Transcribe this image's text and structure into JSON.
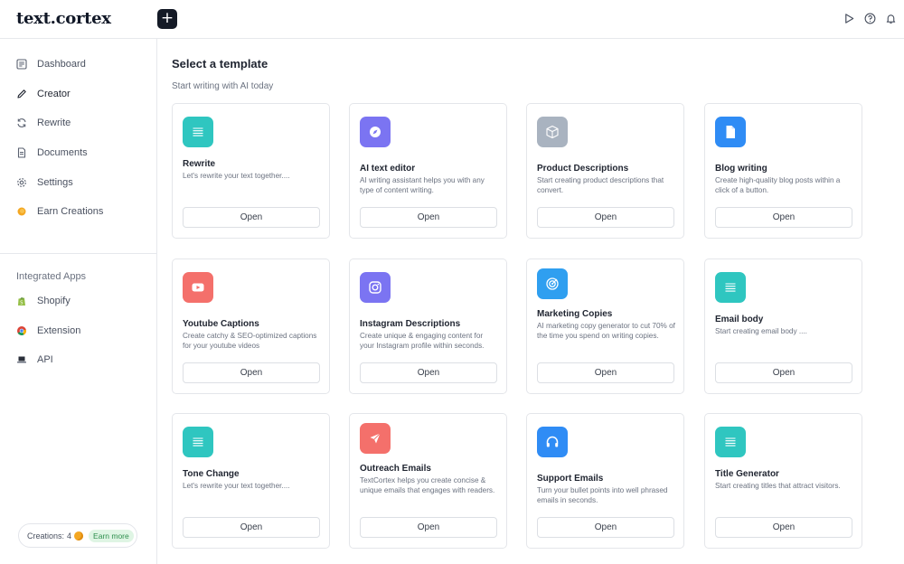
{
  "app": {
    "logo": "text.cortex",
    "new_button": "+"
  },
  "topbar": {
    "icons": [
      "play-icon",
      "help-icon",
      "bell-icon"
    ]
  },
  "sidebar": {
    "items": [
      {
        "label": "Dashboard",
        "icon": "dashboard-icon"
      },
      {
        "label": "Creator",
        "icon": "pencil-icon",
        "active": true
      },
      {
        "label": "Rewrite",
        "icon": "refresh-icon"
      },
      {
        "label": "Documents",
        "icon": "document-icon"
      },
      {
        "label": "Settings",
        "icon": "gear-icon"
      },
      {
        "label": "Earn Creations",
        "icon": "coin-icon"
      }
    ],
    "integrated_title": "Integrated Apps",
    "integrated": [
      {
        "label": "Shopify",
        "icon": "shopify-icon"
      },
      {
        "label": "Extension",
        "icon": "chrome-icon"
      },
      {
        "label": "API",
        "icon": "laptop-icon"
      }
    ],
    "creations": {
      "label": "Creations:",
      "count": "4",
      "earn_more": "Earn more"
    }
  },
  "main": {
    "title": "Select a template",
    "subtitle": "Start writing with AI today",
    "open_label": "Open",
    "cards": [
      {
        "title": "Rewrite",
        "desc": "Let's rewrite your text together....",
        "icon": "lines-icon",
        "color": "#2fc6c0"
      },
      {
        "title": "AI text editor",
        "desc": "AI writing assistant helps you with any type of content writing.",
        "icon": "compass-icon",
        "color": "#7b74f2"
      },
      {
        "title": "Product Descriptions",
        "desc": "Start creating product descriptions that convert.",
        "icon": "box-icon",
        "color": "#a9b3c0"
      },
      {
        "title": "Blog writing",
        "desc": "Create high-quality blog posts within a click of a button.",
        "icon": "file-icon",
        "color": "#2f8cf5"
      },
      {
        "title": "Youtube Captions",
        "desc": "Create catchy & SEO-optimized captions for your youtube videos",
        "icon": "youtube-icon",
        "color": "#f4706b"
      },
      {
        "title": "Instagram Descriptions",
        "desc": "Create unique & engaging content for your Instagram profile within seconds.",
        "icon": "instagram-icon",
        "color": "#7b74f2"
      },
      {
        "title": "Marketing Copies",
        "desc": "AI marketing copy generator to cut 70% of the time you spend on writing copies.",
        "icon": "target-icon",
        "color": "#2f9ff0"
      },
      {
        "title": "Email body",
        "desc": "Start creating email body ....",
        "icon": "lines-icon",
        "color": "#2fc6c0"
      },
      {
        "title": "Tone Change",
        "desc": "Let's rewrite your text together....",
        "icon": "lines-icon",
        "color": "#2fc6c0"
      },
      {
        "title": "Outreach Emails",
        "desc": "TextCortex helps you create concise & unique emails that engages with readers.",
        "icon": "send-icon",
        "color": "#f4706b"
      },
      {
        "title": "Support Emails",
        "desc": "Turn your bullet points into well phrased emails in seconds.",
        "icon": "headphones-icon",
        "color": "#2f8cf5"
      },
      {
        "title": "Title Generator",
        "desc": "Start creating titles that attract visitors.",
        "icon": "lines-icon",
        "color": "#2fc6c0"
      }
    ]
  }
}
